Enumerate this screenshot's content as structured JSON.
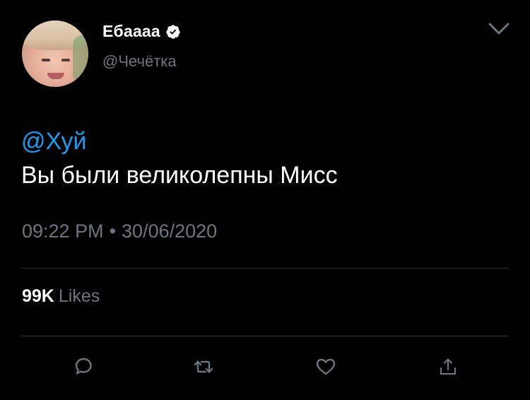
{
  "user": {
    "display_name": "Ебаааа",
    "handle": "@Чечётка",
    "verified": true,
    "avatar_icon": "user-avatar"
  },
  "tweet": {
    "mention": "@Хуй",
    "text": "Вы были великолепны Мисс",
    "time": "09:22 PM",
    "separator": "•",
    "date": "30/06/2020"
  },
  "stats": {
    "likes_count": "99K",
    "likes_label": "Likes"
  },
  "actions": [
    {
      "name": "reply",
      "icon": "comment-icon"
    },
    {
      "name": "retweet",
      "icon": "retweet-icon"
    },
    {
      "name": "like",
      "icon": "heart-icon"
    },
    {
      "name": "share",
      "icon": "share-icon"
    }
  ],
  "colors": {
    "background": "#000000",
    "text": "#ffffff",
    "secondary": "#6e767d",
    "link": "#1d9bf0",
    "divider": "#2f3336"
  }
}
